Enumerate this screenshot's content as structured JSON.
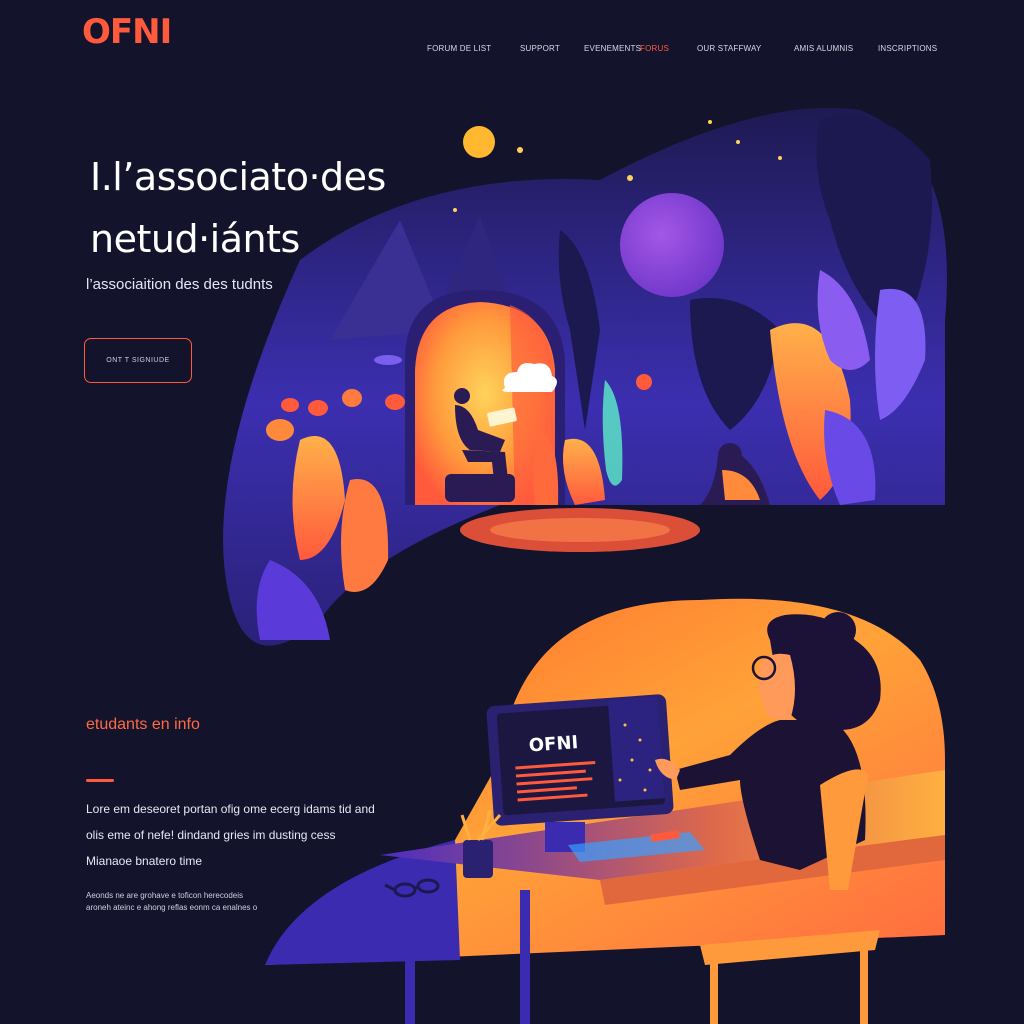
{
  "header": {
    "logo": "OFNI",
    "nav": [
      {
        "label": "FORUM DE LIST",
        "active": false
      },
      {
        "label": "SUPPORT",
        "active": false
      },
      {
        "label": "EVENEMENTS",
        "active": false
      },
      {
        "label": "FORUS",
        "active": true
      },
      {
        "label": "OUR STAFFWAY",
        "active": false
      },
      {
        "label": "AMIS ALUMNIS",
        "active": false
      },
      {
        "label": "INSCRIPTIONS",
        "active": false
      }
    ]
  },
  "hero": {
    "title_line1": "I.l’associato·des",
    "title_line2": "netud·iánts",
    "subtitle": "l’associaition des des tudnts",
    "cta_label": "ONT T SIGNIUDE"
  },
  "info": {
    "section_label": "etudants en info",
    "lines": [
      "Lore em deseoret portan ofig ome ecerg idams tid and",
      "olis eme of nefe! dindand gries im dusting cess",
      "Mianaoe bnatero time"
    ],
    "small_lines": [
      "Aeonds ne are grohave e toficon herecodeis",
      "aroneh ateinc e ahong reflas eonm ca enalnes o"
    ]
  },
  "illustration": {
    "screen_title": "OFNI"
  },
  "colors": {
    "background": "#13132b",
    "accent": "#ff5a3c",
    "text": "#ffffff",
    "purple": "#5a3ad8",
    "orange": "#ff8a3c"
  }
}
